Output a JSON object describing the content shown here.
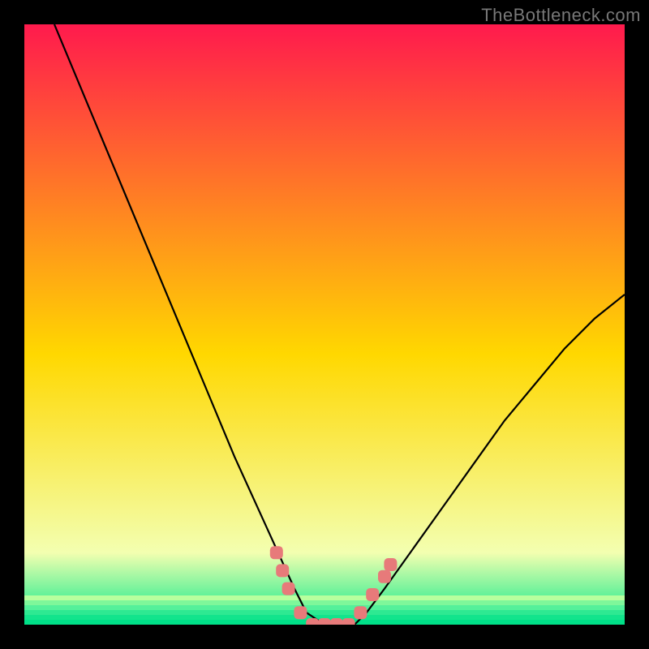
{
  "attribution": "TheBottleneck.com",
  "chart_data": {
    "type": "line",
    "title": "",
    "xlabel": "",
    "ylabel": "",
    "xlim": [
      0,
      100
    ],
    "ylim": [
      0,
      100
    ],
    "grid": false,
    "legend": false,
    "background_gradient": {
      "from_color": "#ff1a4d",
      "mid_color": "#ffd800",
      "to_color": "#00e88a"
    },
    "series": [
      {
        "name": "bottleneck-curve",
        "color": "#000000",
        "x": [
          5,
          10,
          15,
          20,
          25,
          30,
          35,
          40,
          45,
          47,
          50,
          53,
          55,
          57,
          60,
          65,
          70,
          75,
          80,
          85,
          90,
          95,
          100
        ],
        "y": [
          100,
          88,
          76,
          64,
          52,
          40,
          28,
          17,
          6,
          2,
          0,
          0,
          0,
          2,
          6,
          13,
          20,
          27,
          34,
          40,
          46,
          51,
          55
        ]
      }
    ],
    "markers": [
      {
        "name": "highlight-points",
        "shape": "rounded-square",
        "color": "#e77a7a",
        "points": [
          {
            "x": 42,
            "y": 12
          },
          {
            "x": 43,
            "y": 9
          },
          {
            "x": 44,
            "y": 6
          },
          {
            "x": 46,
            "y": 2
          },
          {
            "x": 48,
            "y": 0
          },
          {
            "x": 50,
            "y": 0
          },
          {
            "x": 52,
            "y": 0
          },
          {
            "x": 54,
            "y": 0
          },
          {
            "x": 56,
            "y": 2
          },
          {
            "x": 58,
            "y": 5
          },
          {
            "x": 60,
            "y": 8
          },
          {
            "x": 61,
            "y": 10
          }
        ]
      }
    ],
    "frame_color": "#000000",
    "frame_thickness_px": 30
  }
}
